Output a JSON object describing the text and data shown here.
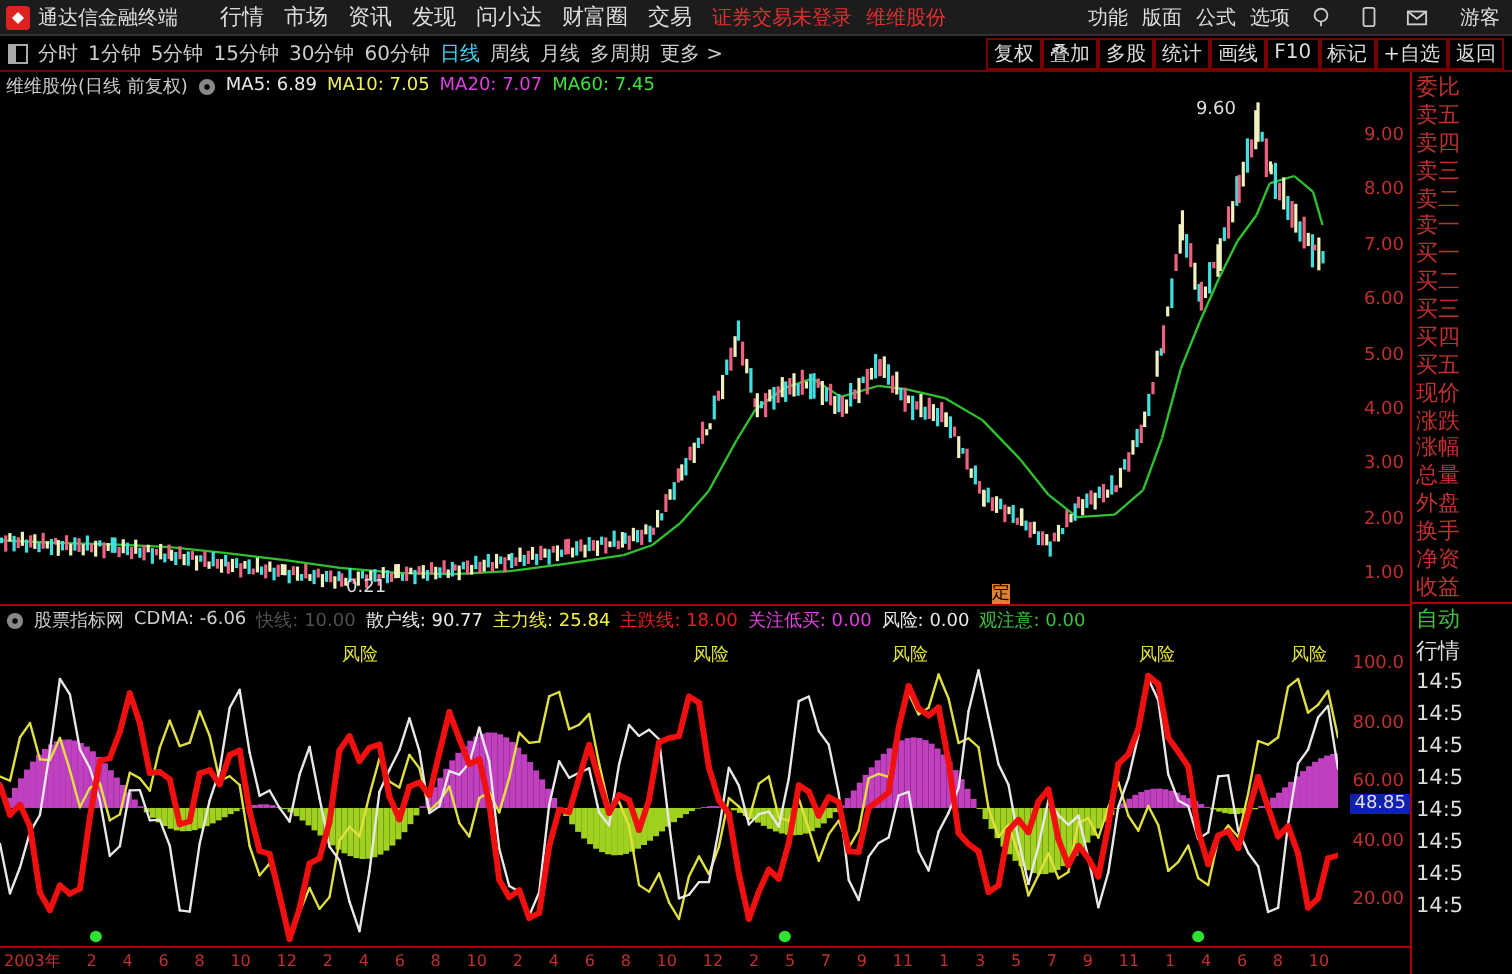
{
  "menu_bar": {
    "app_title": "通达信金融终端",
    "menus": [
      "行情",
      "市场",
      "资讯",
      "发现",
      "问小达",
      "财富圈",
      "交易"
    ],
    "notice": "证券交易未登录",
    "stock": "维维股份",
    "tools": [
      "功能",
      "版面",
      "公式",
      "选项"
    ],
    "user": "游客"
  },
  "period_tabs": [
    {
      "label": "分时",
      "selected": false
    },
    {
      "label": "1分钟",
      "selected": false
    },
    {
      "label": "5分钟",
      "selected": false
    },
    {
      "label": "15分钟",
      "selected": false
    },
    {
      "label": "30分钟",
      "selected": false
    },
    {
      "label": "60分钟",
      "selected": false
    },
    {
      "label": "日线",
      "selected": true
    },
    {
      "label": "周线",
      "selected": false
    },
    {
      "label": "月线",
      "selected": false
    },
    {
      "label": "多周期",
      "selected": false
    },
    {
      "label": "更多 >",
      "selected": false
    }
  ],
  "toolbar_buttons": [
    "复权",
    "叠加",
    "多股",
    "统计",
    "画线",
    "F10",
    "标记",
    "+自选",
    "返回"
  ],
  "price_chart": {
    "legend_title": "维维股份(日线 前复权)",
    "ma": [
      {
        "label": "MA5: 6.89",
        "color": "#e8e8e8"
      },
      {
        "label": "MA10: 7.05",
        "color": "#f0f060"
      },
      {
        "label": "MA20: 7.07",
        "color": "#e040e0"
      },
      {
        "label": "MA60: 7.45",
        "color": "#40e040"
      }
    ],
    "axis_labels": [
      "9.00",
      "8.00",
      "7.00",
      "6.00",
      "5.00",
      "4.00",
      "3.00",
      "2.00",
      "1.00"
    ],
    "high_label": "9.60",
    "low_label": "0.21",
    "event_marker": "定"
  },
  "indicator": {
    "legend_title": "股票指标网",
    "items": [
      {
        "label": "CDMA: -6.06",
        "color": "#d0d0d0"
      },
      {
        "label": "快线: 10.00",
        "color": "#505050"
      },
      {
        "label": "散户线: 90.77",
        "color": "#e8e8e8"
      },
      {
        "label": "主力线: 25.84",
        "color": "#f0f040"
      },
      {
        "label": "主跌线: 18.00",
        "color": "#e02020"
      },
      {
        "label": "关注低买: 0.00",
        "color": "#e040e0"
      },
      {
        "label": "风险: 0.00",
        "color": "#e8e8e8"
      },
      {
        "label": "观注意: 0.00",
        "color": "#40c040"
      }
    ],
    "axis_labels": [
      "100.0",
      "80.00",
      "60.00",
      "40.00",
      "20.00"
    ],
    "current_value": "48.85",
    "risk_labels": [
      "风险",
      "风险",
      "风险",
      "风险",
      "风险"
    ]
  },
  "side_panel": {
    "quote_labels": [
      "委比",
      "卖五",
      "卖四",
      "卖三",
      "卖二",
      "卖一",
      "买一",
      "买二",
      "买三",
      "买四",
      "买五",
      "现价",
      "涨跌",
      "涨幅",
      "总量",
      "外盘",
      "换手",
      "净资",
      "收益"
    ],
    "tabs": [
      "自动",
      "行情"
    ],
    "ticks": [
      "14:5",
      "14:5",
      "14:5",
      "14:5",
      "14:5",
      "14:5",
      "14:5",
      "14:5"
    ]
  },
  "time_axis": [
    "2003年",
    "2",
    "4",
    "6",
    "8",
    "10",
    "12",
    "2",
    "4",
    "6",
    "8",
    "10",
    "2",
    "4",
    "6",
    "8",
    "10",
    "12",
    "2",
    "5",
    "7",
    "9",
    "11",
    "1",
    "3",
    "5",
    "7",
    "9",
    "11",
    "1",
    "4",
    "6",
    "8",
    "10"
  ]
}
